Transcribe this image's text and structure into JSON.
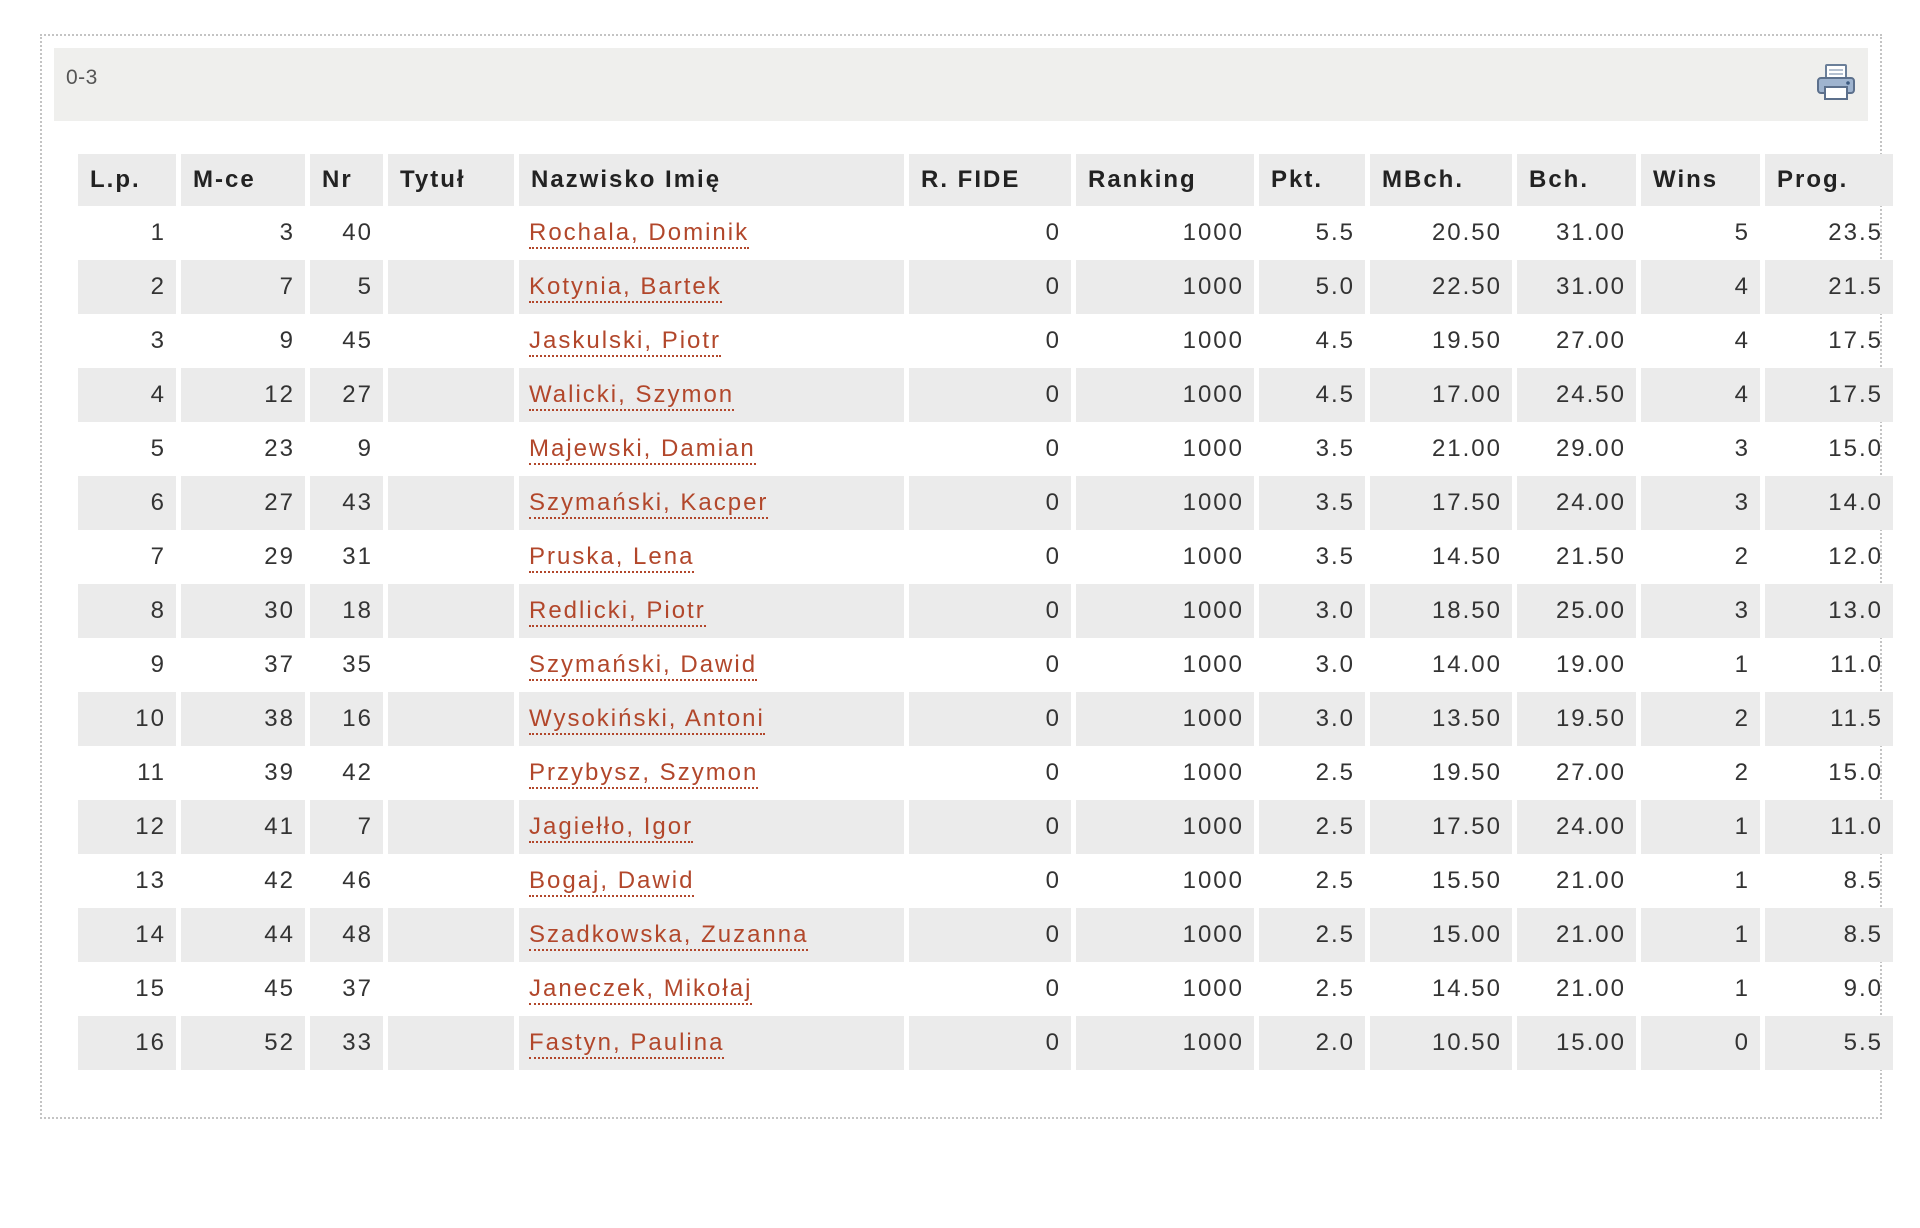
{
  "panel": {
    "title": "0-3",
    "print_icon": "printer-icon"
  },
  "colors": {
    "link": "#b2472b",
    "row_stripe": "#ebebeb",
    "header_bg": "#efefed"
  },
  "table": {
    "headers": [
      "L.p.",
      "M-ce",
      "Nr",
      "Tytuł",
      "Nazwisko Imię",
      "R. FIDE",
      "Ranking",
      "Pkt.",
      "MBch.",
      "Bch.",
      "Wins",
      "Prog."
    ],
    "rows": [
      [
        "1",
        "3",
        "40",
        "",
        "Rochala, Dominik",
        "0",
        "1000",
        "5.5",
        "20.50",
        "31.00",
        "5",
        "23.5"
      ],
      [
        "2",
        "7",
        "5",
        "",
        "Kotynia, Bartek",
        "0",
        "1000",
        "5.0",
        "22.50",
        "31.00",
        "4",
        "21.5"
      ],
      [
        "3",
        "9",
        "45",
        "",
        "Jaskulski, Piotr",
        "0",
        "1000",
        "4.5",
        "19.50",
        "27.00",
        "4",
        "17.5"
      ],
      [
        "4",
        "12",
        "27",
        "",
        "Walicki, Szymon",
        "0",
        "1000",
        "4.5",
        "17.00",
        "24.50",
        "4",
        "17.5"
      ],
      [
        "5",
        "23",
        "9",
        "",
        "Majewski, Damian",
        "0",
        "1000",
        "3.5",
        "21.00",
        "29.00",
        "3",
        "15.0"
      ],
      [
        "6",
        "27",
        "43",
        "",
        "Szymański, Kacper",
        "0",
        "1000",
        "3.5",
        "17.50",
        "24.00",
        "3",
        "14.0"
      ],
      [
        "7",
        "29",
        "31",
        "",
        "Pruska, Lena",
        "0",
        "1000",
        "3.5",
        "14.50",
        "21.50",
        "2",
        "12.0"
      ],
      [
        "8",
        "30",
        "18",
        "",
        "Redlicki, Piotr",
        "0",
        "1000",
        "3.0",
        "18.50",
        "25.00",
        "3",
        "13.0"
      ],
      [
        "9",
        "37",
        "35",
        "",
        "Szymański, Dawid",
        "0",
        "1000",
        "3.0",
        "14.00",
        "19.00",
        "1",
        "11.0"
      ],
      [
        "10",
        "38",
        "16",
        "",
        "Wysokiński, Antoni",
        "0",
        "1000",
        "3.0",
        "13.50",
        "19.50",
        "2",
        "11.5"
      ],
      [
        "11",
        "39",
        "42",
        "",
        "Przybysz, Szymon",
        "0",
        "1000",
        "2.5",
        "19.50",
        "27.00",
        "2",
        "15.0"
      ],
      [
        "12",
        "41",
        "7",
        "",
        "Jagiełło, Igor",
        "0",
        "1000",
        "2.5",
        "17.50",
        "24.00",
        "1",
        "11.0"
      ],
      [
        "13",
        "42",
        "46",
        "",
        "Bogaj, Dawid",
        "0",
        "1000",
        "2.5",
        "15.50",
        "21.00",
        "1",
        "8.5"
      ],
      [
        "14",
        "44",
        "48",
        "",
        "Szadkowska, Zuzanna",
        "0",
        "1000",
        "2.5",
        "15.00",
        "21.00",
        "1",
        "8.5"
      ],
      [
        "15",
        "45",
        "37",
        "",
        "Janeczek, Mikołaj",
        "0",
        "1000",
        "2.5",
        "14.50",
        "21.00",
        "1",
        "9.0"
      ],
      [
        "16",
        "52",
        "33",
        "",
        "Fastyn, Paulina",
        "0",
        "1000",
        "2.0",
        "10.50",
        "15.00",
        "0",
        "5.5"
      ]
    ]
  }
}
